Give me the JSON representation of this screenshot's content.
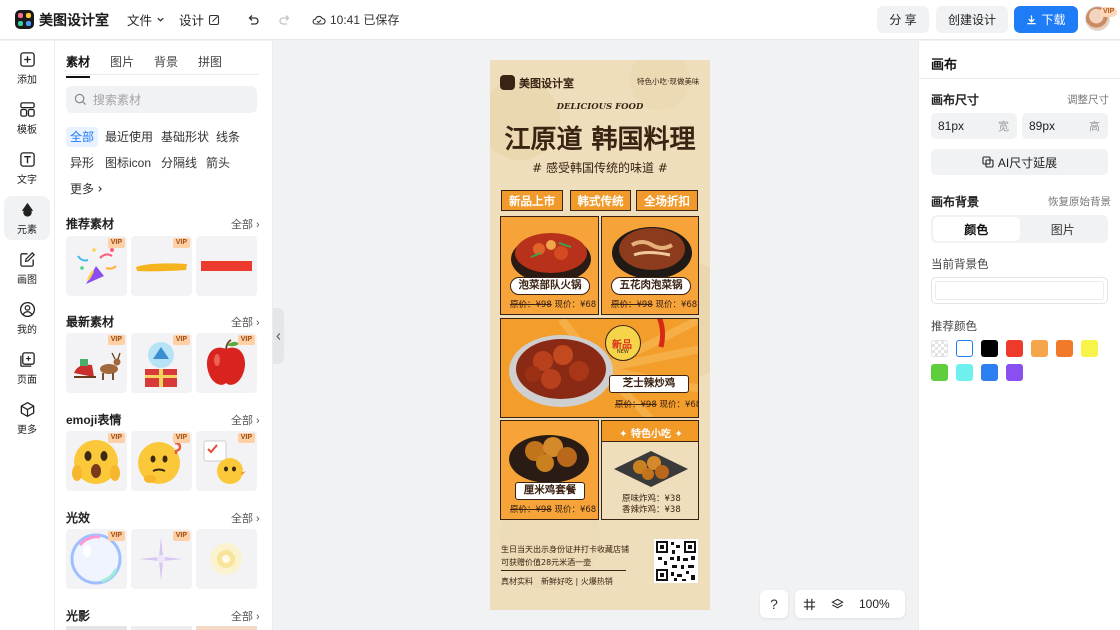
{
  "app": {
    "name": "美图设计室",
    "menu_file": "文件",
    "menu_design": "设计",
    "save_status": "10:41 已保存",
    "share_label": "分 享",
    "create_label": "创建设计",
    "download_label": "下载",
    "avatar_badge": "VIP"
  },
  "rail": [
    {
      "label": "添加",
      "icon": "plus-square-icon"
    },
    {
      "label": "模板",
      "icon": "template-icon"
    },
    {
      "label": "文字",
      "icon": "text-icon"
    },
    {
      "label": "元素",
      "icon": "shapes-icon"
    },
    {
      "label": "画图",
      "icon": "draw-icon"
    },
    {
      "label": "我的",
      "icon": "user-icon"
    },
    {
      "label": "页面",
      "icon": "page-icon"
    },
    {
      "label": "更多",
      "icon": "cube-icon"
    }
  ],
  "panel": {
    "tabs": [
      "素材",
      "图片",
      "背景",
      "拼图"
    ],
    "search_placeholder": "搜索素材",
    "chips": [
      "全部",
      "最近使用",
      "基础形状",
      "线条",
      "异形",
      "图标icon",
      "分隔线",
      "箭头",
      "更多"
    ],
    "sections": [
      {
        "title": "推荐素材",
        "more": "全部"
      },
      {
        "title": "最新素材",
        "more": "全部"
      },
      {
        "title": "emoji表情",
        "more": "全部"
      },
      {
        "title": "光效",
        "more": "全部"
      },
      {
        "title": "光影",
        "more": "全部"
      }
    ],
    "vip": "VIP"
  },
  "poster": {
    "brand": "美图设计室",
    "slogan": "特色小吃·现做美味",
    "delicious": "DELICIOUS FOOD",
    "title": "江原道 韩国料理",
    "subtitle": "# 感受韩国传统的味道 #",
    "tags": [
      "新品上市",
      "韩式传统",
      "全场折扣"
    ],
    "dishes": [
      {
        "name": "泡菜部队火锅",
        "old": "原价：¥98",
        "now": "现价：¥68"
      },
      {
        "name": "五花肉泡菜锅",
        "old": "原价：¥98",
        "now": "现价：¥68"
      },
      {
        "name": "芝士辣炒鸡",
        "old": "原价：¥98",
        "now": "现价：¥68"
      },
      {
        "name": "厘米鸡套餐",
        "old": "原价：¥98",
        "now": "现价：¥68"
      }
    ],
    "new_badge": "新品",
    "new_badge_en": "NEW",
    "snack_title": "特色小吃",
    "snack_prices": [
      "原味炸鸡：¥38",
      "香辣炸鸡：¥38"
    ],
    "footer_line1": "生日当天出示身份证并打卡收藏店铺",
    "footer_line2": "可获赠价值28元米酒一壶",
    "footer_line3": "真材实料　新鲜好吃 | 火爆热销"
  },
  "canvas_toolbar": {
    "help": "?",
    "zoom": "100%"
  },
  "props": {
    "title": "画布",
    "size_label": "画布尺寸",
    "size_link": "调整尺寸",
    "width_value": "81px",
    "width_unit": "宽",
    "height_value": "89px",
    "height_unit": "高",
    "ai_button": "AI尺寸延展",
    "bg_label": "画布背景",
    "bg_reset": "恢复原始背景",
    "seg_color": "颜色",
    "seg_image": "图片",
    "current_bg_label": "当前背景色",
    "current_bg_color": "#ffffff",
    "recommend_label": "推荐颜色",
    "colors": [
      "transparent",
      "#ffffff",
      "#000000",
      "#ee3a2a",
      "#f5a64a",
      "#f07a29",
      "#f7f349",
      "#5fce3c",
      "#6ef0ee",
      "#2b7ff0",
      "#8a4ff0"
    ]
  }
}
